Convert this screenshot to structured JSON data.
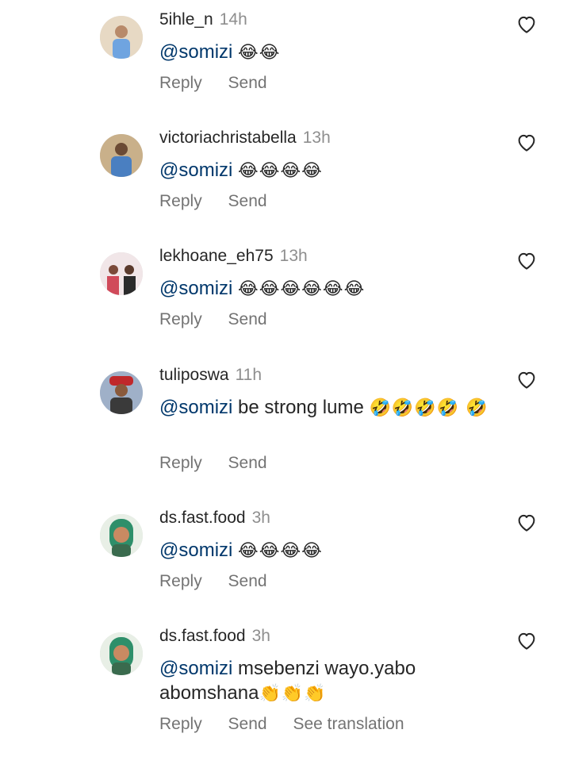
{
  "comments": [
    {
      "username": "5ihle_n",
      "time": "14h",
      "mention": "@somizi",
      "text": "",
      "emojis": "😂😂",
      "reply_label": "Reply",
      "send_label": "Send",
      "avatar_icon": "avatar-photo-icon",
      "accent": "#5b8fd6"
    },
    {
      "username": "victoriachristabella",
      "time": "13h",
      "mention": "@somizi",
      "text": "",
      "emojis": "😂😂😂😂",
      "reply_label": "Reply",
      "send_label": "Send",
      "avatar_icon": "avatar-photo-icon",
      "accent": "#4a7fc1"
    },
    {
      "username": "lekhoane_eh75",
      "time": "13h",
      "mention": "@somizi",
      "text": "",
      "emojis": "😂😂😂😂😂😂",
      "reply_label": "Reply",
      "send_label": "Send",
      "avatar_icon": "avatar-photo-icon",
      "accent": "#d04a5a"
    },
    {
      "username": "tuliposwa",
      "time": "11h",
      "mention": "@somizi",
      "text": "be strong lume",
      "emojis": "🤣🤣🤣🤣 🤣",
      "reply_label": "Reply",
      "send_label": "Send",
      "avatar_icon": "avatar-photo-icon",
      "accent": "#c0282b"
    },
    {
      "username": "ds.fast.food",
      "time": "3h",
      "mention": "@somizi",
      "text": "",
      "emojis": "😂😂😂😂",
      "reply_label": "Reply",
      "send_label": "Send",
      "avatar_icon": "avatar-photo-icon",
      "accent": "#2e8f6a"
    },
    {
      "username": "ds.fast.food",
      "time": "3h",
      "mention": "@somizi",
      "text": "msebenzi wayo.yabo abomshana",
      "emojis": "👏👏👏",
      "reply_label": "Reply",
      "send_label": "Send",
      "translate_label": "See translation",
      "avatar_icon": "avatar-photo-icon",
      "accent": "#2e8f6a"
    }
  ],
  "icons": {
    "like": "heart-outline-icon"
  },
  "colors": {
    "mention": "#00376b",
    "meta": "#8e8e8e",
    "text": "#262626"
  }
}
